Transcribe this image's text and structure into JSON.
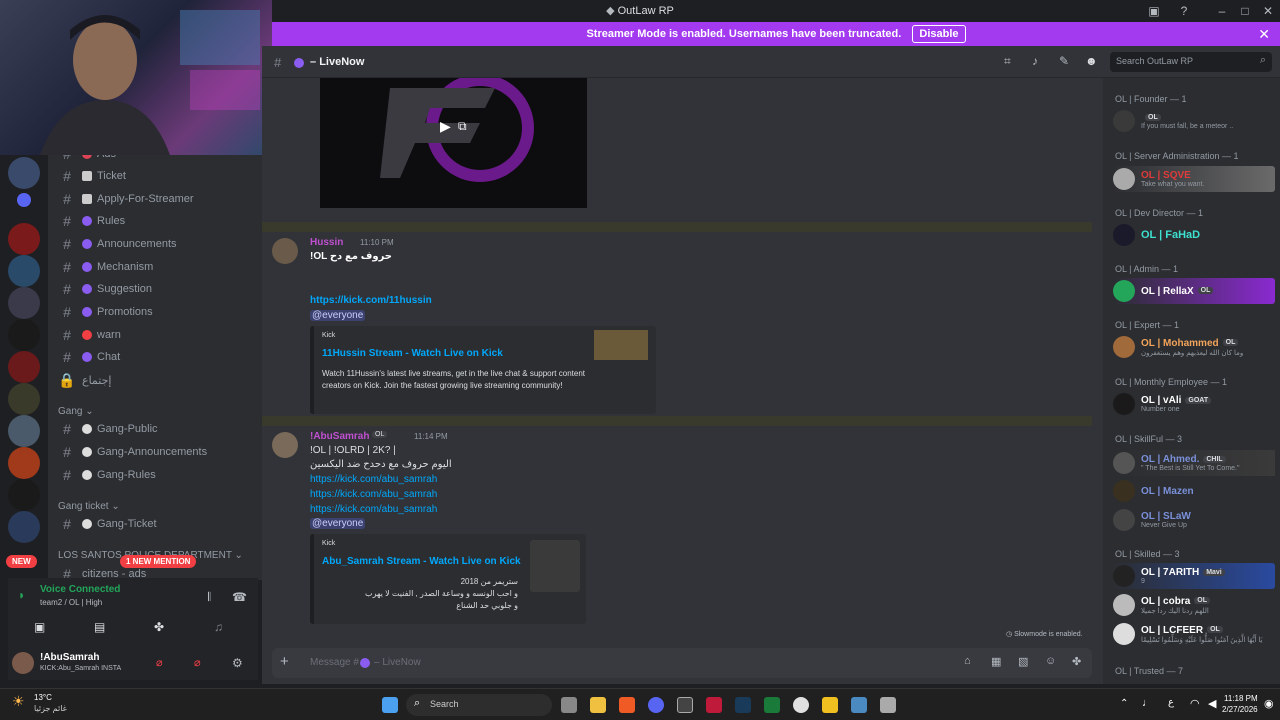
{
  "window": {
    "title": "OutLaw RP"
  },
  "banner": {
    "text": "Streamer Mode is enabled. Usernames have been truncated.",
    "button": "Disable"
  },
  "channel_header": {
    "name": "LiveNow",
    "search_placeholder": "Search OutLaw RP"
  },
  "sidebar": {
    "channels": [
      {
        "label": "Ads"
      },
      {
        "label": "Ticket"
      },
      {
        "label": "Apply-For-Streamer"
      },
      {
        "label": "Rules"
      },
      {
        "label": "Announcements"
      },
      {
        "label": "Mechanism"
      },
      {
        "label": "Suggestion"
      },
      {
        "label": "Promotions"
      },
      {
        "label": "warn"
      },
      {
        "label": "Chat"
      },
      {
        "label": "إجتماع"
      }
    ],
    "gang_category": "Gang",
    "gang_channels": [
      {
        "label": "Gang-Public"
      },
      {
        "label": "Gang-Announcements"
      },
      {
        "label": "Gang-Rules"
      }
    ],
    "ticket_category": "Gang ticket",
    "ticket_channels": [
      {
        "label": "Gang-Ticket"
      }
    ],
    "police_category": "LOS SANTOS POLICE DEPARTMENT",
    "police_channels": [
      {
        "label": "citizens - ads"
      }
    ],
    "new_badge": "NEW",
    "new_mention": "1 NEW MENTION"
  },
  "voice": {
    "status": "Voice Connected",
    "channel": "team2 / OL | High"
  },
  "user": {
    "name": "!AbuSamrah",
    "status": "KICK:Abu_Samrah INSTA"
  },
  "messages": [
    {
      "author": "Hussin",
      "time": "11:10 PM",
      "text": "!OL حروف مع دح",
      "link": "https://kick.com/11hussin",
      "mention": "@everyone",
      "embed": {
        "provider": "Kick",
        "title": "11Hussin Stream - Watch Live on Kick",
        "description": "Watch 11Hussin's latest live streams, get in the live chat & support content creators on Kick. Join the fastest growing live streaming community!"
      }
    },
    {
      "author": "!AbuSamrah",
      "badge": "OL",
      "time": "11:14 PM",
      "text": "!OL | !OLRD | 2K? |",
      "text2": "اليوم حروف مع دحدح ضد اليكسين",
      "links": [
        "https://kick.com/abu_samrah",
        "https://kick.com/abu_samrah",
        "https://kick.com/abu_samrah"
      ],
      "mention": "@everyone",
      "embed": {
        "provider": "Kick",
        "title": "Abu_Samrah Stream - Watch Live on Kick",
        "lines": [
          "ستريمر من 2018",
          "و احب الونسه و وساعة الصدر , الفنيت لا يهرب",
          "و جلوبي حد الشناع"
        ]
      }
    }
  ],
  "slowmode": "Slowmode is enabled.",
  "composer": {
    "placeholder": "Message #",
    "channel": "LiveNow"
  },
  "members": {
    "groups": [
      {
        "name": "OL | Founder — 1"
      },
      {
        "name": "OL | Server Administration — 1"
      },
      {
        "name": "OL | Dev Director — 1"
      },
      {
        "name": "OL | Admin — 1"
      },
      {
        "name": "OL | Expert — 1"
      },
      {
        "name": "OL | Monthly Employee — 1"
      },
      {
        "name": "OL | SkillFul — 3"
      },
      {
        "name": "OL | Skilled — 3"
      },
      {
        "name": "OL | Trusted — 7"
      }
    ],
    "rows": [
      {
        "name": "",
        "status": "If you must fall, be a meteor ..",
        "tag": "OL",
        "color": "#e03b3b"
      },
      {
        "name": "OL | SQVE",
        "status": "Take what you want.",
        "color": "#e03b3b"
      },
      {
        "name": "OL | FaHaD",
        "status": "",
        "color": "#3ee0d0"
      },
      {
        "name": "OL | RellaX",
        "status": "",
        "tag": "OL",
        "color": "#ffffff"
      },
      {
        "name": "OL | Mohammed",
        "status": "وما كان الله ليعذبهم وهم يستغفرون",
        "tag": "OL",
        "color": "#f2a45b"
      },
      {
        "name": "OL | vAli",
        "status": "Number one",
        "tag": "GOAT",
        "color": "#ffffff"
      },
      {
        "name": "OL | Ahmed.",
        "status": "\" The Best is Still Yet To Come.\"",
        "tag": "CHIL",
        "color": "#7a90d8"
      },
      {
        "name": "OL | Mazen",
        "status": "",
        "color": "#7a90d8"
      },
      {
        "name": "OL | SLaW",
        "status": "Never Give Up",
        "color": "#7a90d8"
      },
      {
        "name": "OL | 7ARITH",
        "status": "9",
        "tag": "Mavi",
        "color": "#ffffff"
      },
      {
        "name": "OL | cobra",
        "status": "اللهم ردنا اليك ردا جميلا",
        "tag": "OL",
        "color": "#ffffff"
      },
      {
        "name": "OL | LCFEER",
        "status": "يَا أَيُّهَا الَّذِينَ آمَنُوا صَلُّوا عَلَيْهِ وَسَلِّمُوا تَسْلِيمًا",
        "tag": "OL",
        "color": "#ffffff"
      }
    ]
  },
  "taskbar": {
    "weather_temp": "13°C",
    "weather_desc": "غائم جزئيا",
    "search": "Search",
    "time": "11:18 PM",
    "date": "2/27/2026",
    "lang": "ع"
  },
  "colors": {
    "accent": "#a33af0",
    "link": "#00a8fc",
    "online": "#23a55a",
    "dnd": "#f23f43"
  }
}
